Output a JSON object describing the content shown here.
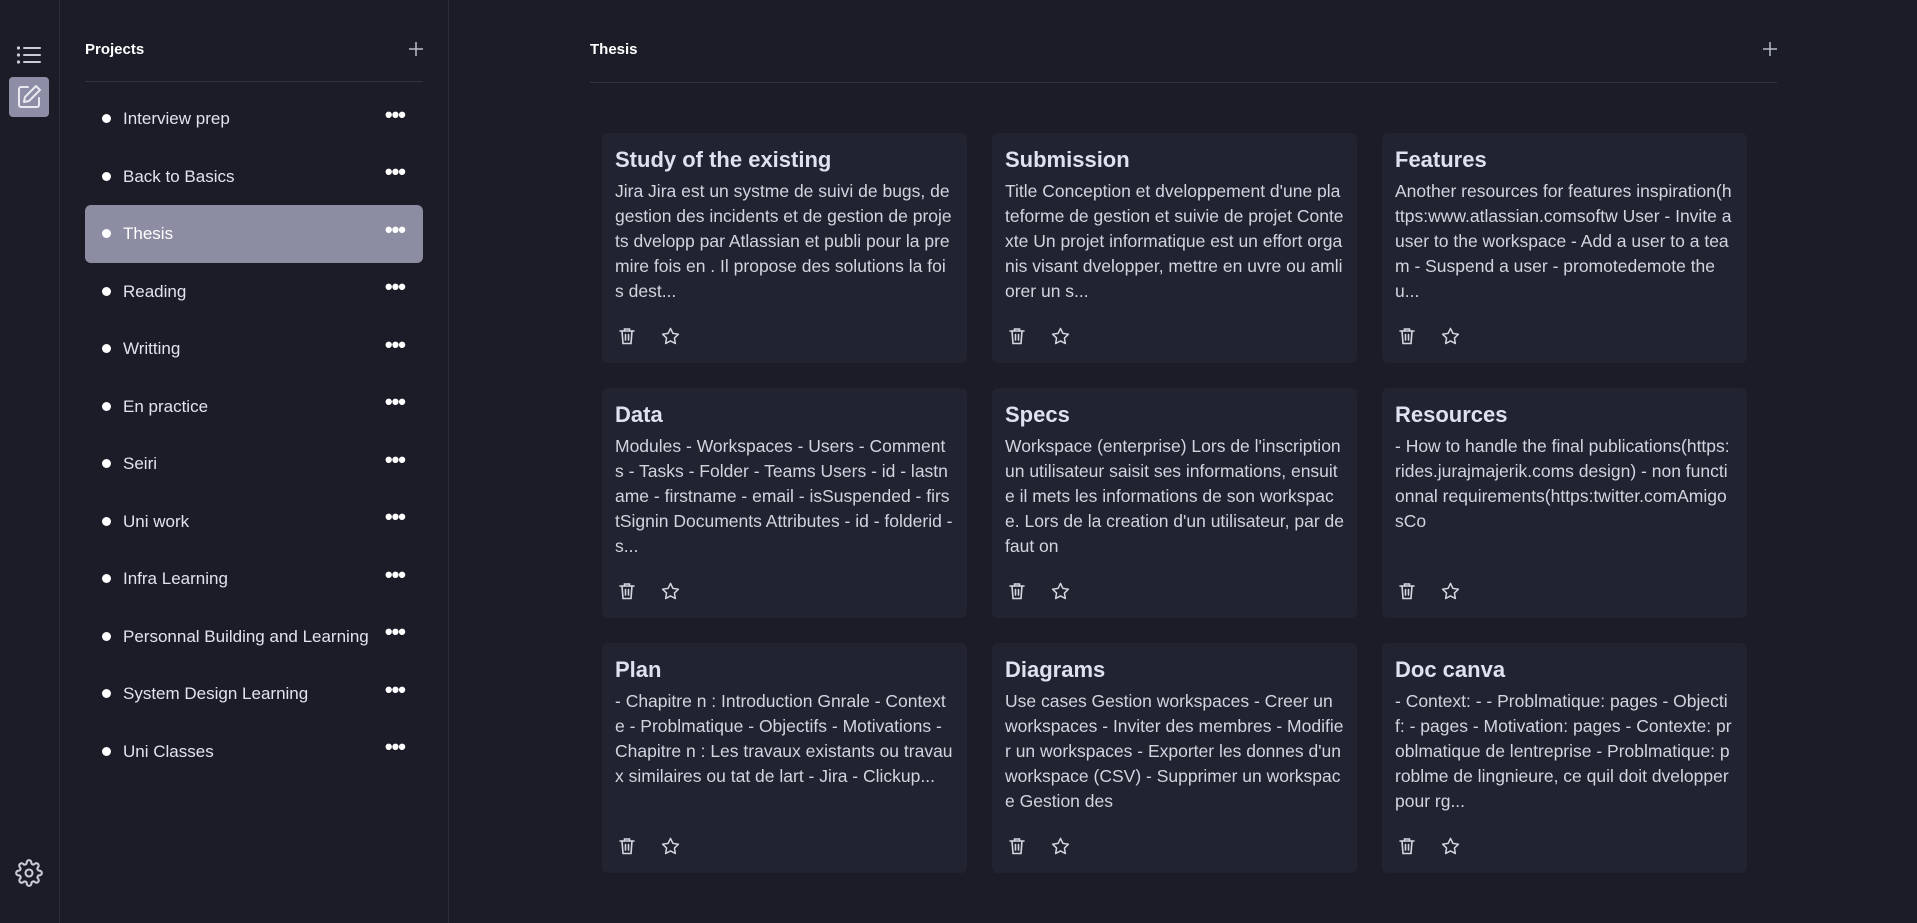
{
  "rail": {
    "items": [
      {
        "icon": "list-icon"
      },
      {
        "icon": "edit-icon",
        "active": true
      }
    ],
    "settings_icon": "gear-icon"
  },
  "sidebar": {
    "title": "Projects",
    "add_icon": "plus-icon",
    "items": [
      {
        "label": "Interview prep"
      },
      {
        "label": "Back to Basics"
      },
      {
        "label": "Thesis",
        "active": true
      },
      {
        "label": "Reading"
      },
      {
        "label": "Writting"
      },
      {
        "label": "En practice"
      },
      {
        "label": "Seiri"
      },
      {
        "label": "Uni work"
      },
      {
        "label": "Infra Learning"
      },
      {
        "label": "Personnal Building and Learning"
      },
      {
        "label": "System Design Learning"
      },
      {
        "label": "Uni Classes"
      }
    ]
  },
  "main": {
    "title": "Thesis",
    "add_icon": "plus-icon",
    "cards": [
      {
        "title": "Study of the existing",
        "body": "Jira Jira est un systme de suivi de bugs, de gestion des incidents et de gestion de projets dvelopp par Atlassian et publi pour la premire fois en . Il propose des solutions la fois dest..."
      },
      {
        "title": "Submission",
        "body": "Title Conception et dveloppement d'une plateforme de gestion et suivie de projet Contexte Un projet informatique est un effort organis visant dvelopper, mettre en uvre ou amliorer un s..."
      },
      {
        "title": "Features",
        "body": "Another resources for features inspiration(https:www.atlassian.comsoftw User - Invite a user to the workspace - Add a user to a team - Suspend a user - promotedemote the u..."
      },
      {
        "title": "Data",
        "body": "Modules - Workspaces - Users - Comments - Tasks - Folder - Teams Users - id - lastname - firstname - email - isSuspended - firstSignin Documents Attributes - id - folderid - s..."
      },
      {
        "title": "Specs",
        "body": "Workspace (enterprise) Lors de l'inscription un utilisateur saisit ses informations, ensuite il mets les informations de son workspace. Lors de la creation d'un utilisateur, par defaut on"
      },
      {
        "title": "Resources",
        "body": "- How to handle the final publications(https:rides.jurajmajerik.coms design) - non functionnal requirements(https:twitter.comAmigosCo"
      },
      {
        "title": "Plan",
        "body": "- Chapitre n : Introduction Gnrale - Contexte - Problmatique - Objectifs - Motivations - Chapitre n : Les travaux existants ou travaux similaires ou tat de lart - Jira - Clickup..."
      },
      {
        "title": "Diagrams",
        "body": "Use cases Gestion workspaces - Creer un workspaces - Inviter des membres - Modifier un workspaces - Exporter les donnes d'un workspace (CSV) - Supprimer un workspace Gestion des"
      },
      {
        "title": "Doc canva",
        "body": "- Context: - - Problmatique: pages - Objectif: - pages - Motivation: pages - Contexte: problmatique de lentreprise - Problmatique: problme de lingnieure, ce quil doit dvelopper pour rg..."
      }
    ],
    "card_action_icons": [
      "trash-icon",
      "star-icon"
    ]
  },
  "colors": {
    "background": "#1b1c27",
    "card": "#222331",
    "active_item": "#8c8ca3",
    "text": "#e4e6f0"
  }
}
